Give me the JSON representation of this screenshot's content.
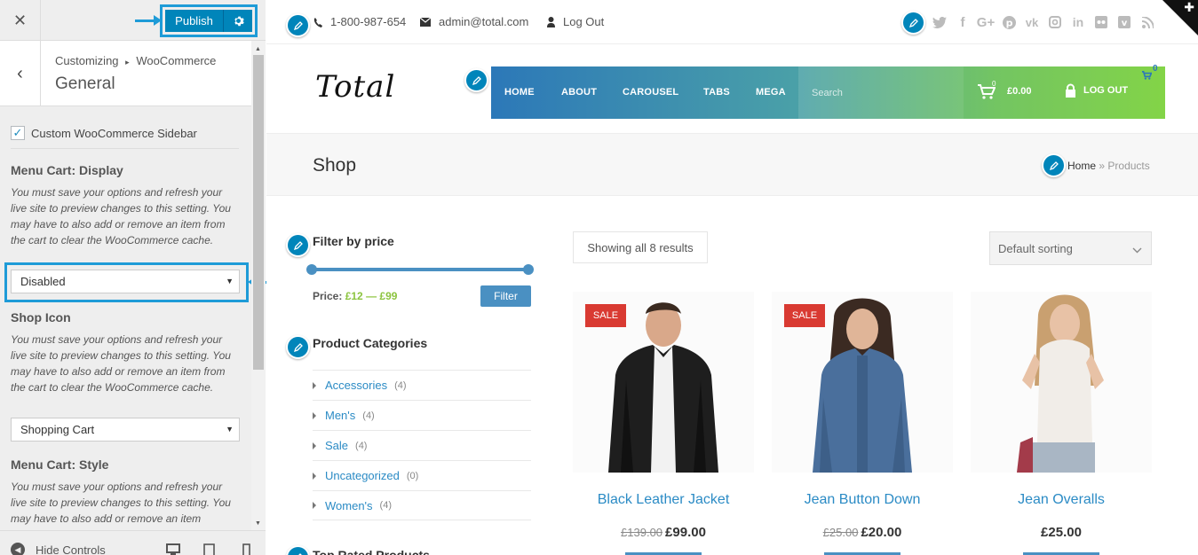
{
  "customizer": {
    "close_icon": "close-icon",
    "publish_label": "Publish",
    "breadcrumb_prefix": "Customizing",
    "breadcrumb_section": "WooCommerce",
    "section_title": "General",
    "checkbox_label": "Custom WooCommerce Sidebar",
    "controls": [
      {
        "label": "Menu Cart: Display",
        "description": "You must save your options and refresh your live site to preview changes to this setting. You may have to also add or remove an item from the cart to clear the WooCommerce cache.",
        "value": "Disabled"
      },
      {
        "label": "Shop Icon",
        "description": "You must save your options and refresh your live site to preview changes to this setting. You may have to also add or remove an item from the cart to clear the WooCommerce cache.",
        "value": "Shopping Cart"
      },
      {
        "label": "Menu Cart: Style",
        "description": "You must save your options and refresh your live site to preview changes to this setting. You may have to also add or remove an item"
      }
    ],
    "hide_controls_label": "Hide Controls"
  },
  "topbar": {
    "phone": "1-800-987-654",
    "email": "admin@total.com",
    "logout": "Log Out"
  },
  "header": {
    "logo": "Total",
    "nav": [
      "HOME",
      "ABOUT",
      "CAROUSEL",
      "TABS",
      "MEGA"
    ],
    "search_placeholder": "Search",
    "cart_count": "0",
    "cart_amount": "£0.00",
    "logout": "LOG OUT",
    "cart_badge": "0"
  },
  "pagehead": {
    "title": "Shop",
    "crumb_home": "Home",
    "crumb_sep": "»",
    "crumb_current": "Products"
  },
  "sidebar": {
    "filter_title": "Filter by price",
    "price_prefix": "Price:",
    "price_min": "£12",
    "price_dash": "—",
    "price_max": "£99",
    "filter_button": "Filter",
    "categories_title": "Product Categories",
    "categories": [
      {
        "name": "Accessories",
        "count": "(4)"
      },
      {
        "name": "Men's",
        "count": "(4)"
      },
      {
        "name": "Sale",
        "count": "(4)"
      },
      {
        "name": "Uncategorized",
        "count": "(0)"
      },
      {
        "name": "Women's",
        "count": "(4)"
      }
    ],
    "top_rated_title": "Top Rated Products"
  },
  "shop": {
    "results": "Showing all 8 results",
    "sorting": "Default sorting",
    "products": [
      {
        "name": "Black Leather Jacket",
        "old_price": "£139.00",
        "price": "£99.00",
        "badge": "SALE"
      },
      {
        "name": "Jean Button Down",
        "old_price": "£25.00",
        "price": "£20.00",
        "badge": "SALE"
      },
      {
        "name": "Jean Overalls",
        "old_price": "",
        "price": "£25.00",
        "badge": ""
      }
    ]
  },
  "colors": {
    "accent": "#0085ba",
    "highlight": "#1e9bd7",
    "link": "#2b8bc5",
    "sale": "#d93a32"
  }
}
